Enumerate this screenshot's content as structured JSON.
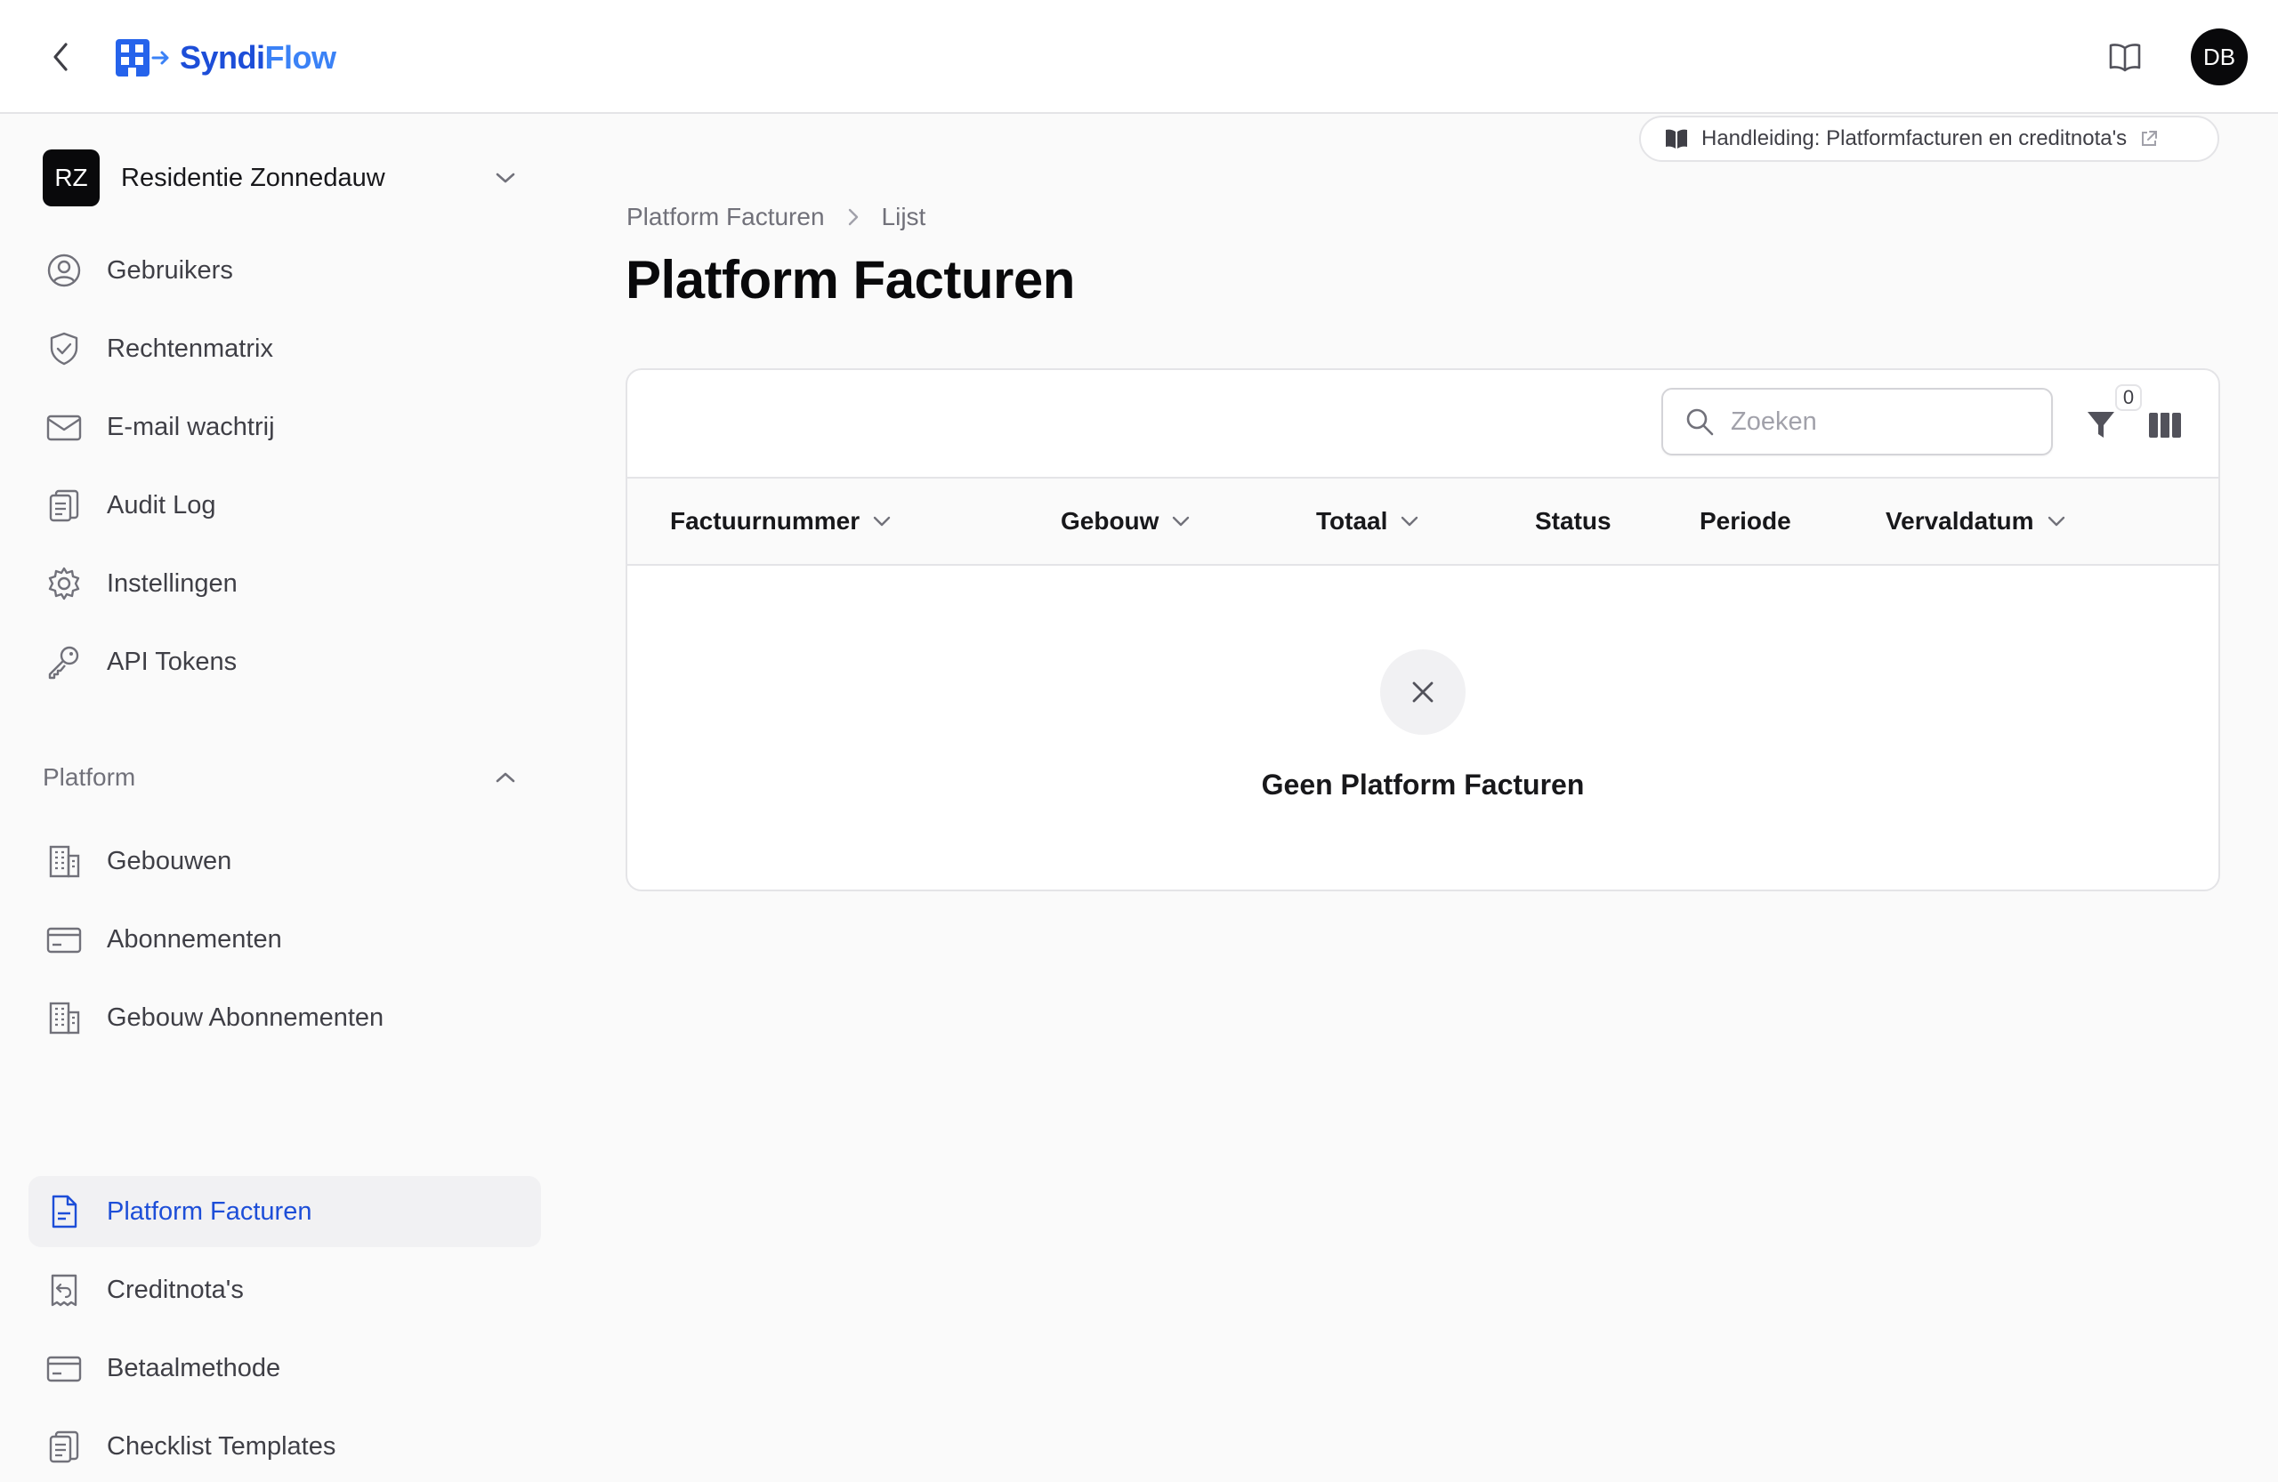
{
  "header": {
    "brand_part1": "Syndi",
    "brand_part2": "Flow",
    "avatar_initials": "DB"
  },
  "sidebar": {
    "tenant": {
      "initials": "RZ",
      "name": "Residentie Zonnedauw"
    },
    "items": [
      {
        "label": "Gebruikers",
        "icon": "user-circle-icon"
      },
      {
        "label": "Rechtenmatrix",
        "icon": "shield-check-icon"
      },
      {
        "label": "E-mail wachtrij",
        "icon": "envelope-icon"
      },
      {
        "label": "Audit Log",
        "icon": "clipboard-icon"
      },
      {
        "label": "Instellingen",
        "icon": "gear-icon"
      },
      {
        "label": "API Tokens",
        "icon": "key-icon"
      }
    ],
    "platform_section": {
      "title": "Platform",
      "items": [
        {
          "label": "Gebouwen",
          "icon": "building-icon"
        },
        {
          "label": "Abonnementen",
          "icon": "credit-card-icon"
        },
        {
          "label": "Gebouw Abonnementen",
          "icon": "building-icon"
        },
        {
          "label": "Platform Facturen",
          "icon": "document-icon",
          "active": true
        },
        {
          "label": "Creditnota's",
          "icon": "receipt-refund-icon"
        },
        {
          "label": "Betaalmethode",
          "icon": "credit-card-icon"
        },
        {
          "label": "Checklist Templates",
          "icon": "clipboard-icon"
        }
      ]
    }
  },
  "guide_link": {
    "label": "Handleiding: Platformfacturen en creditnota's"
  },
  "breadcrumb": {
    "parent": "Platform Facturen",
    "current": "Lijst"
  },
  "page": {
    "title": "Platform Facturen"
  },
  "table": {
    "search_placeholder": "Zoeken",
    "filter_count": "0",
    "columns": [
      {
        "label": "Factuurnummer",
        "sortable": true
      },
      {
        "label": "Gebouw",
        "sortable": true
      },
      {
        "label": "Totaal",
        "sortable": true
      },
      {
        "label": "Status",
        "sortable": false
      },
      {
        "label": "Periode",
        "sortable": false
      },
      {
        "label": "Vervaldatum",
        "sortable": true
      }
    ],
    "rows": [],
    "empty_message": "Geen Platform Facturen"
  },
  "colors": {
    "accent": "#1d4ed8",
    "brand": "#3b82f6",
    "dark": "#09090b"
  }
}
